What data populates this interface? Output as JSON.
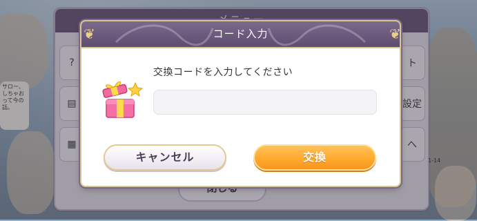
{
  "background": {
    "menu_title": "メニュー",
    "close_label": "閉じる",
    "side_items": [
      "ト",
      "設定",
      "へ"
    ],
    "chat_text": "サロー、しちゃおって今の話。",
    "date_text": "1-14",
    "colors": {
      "menu_header": "#6d5c7e"
    }
  },
  "dialog": {
    "title": "コード入力",
    "prompt": "交換コードを入力してください",
    "input": {
      "value": "",
      "placeholder": ""
    },
    "cancel_label": "キャンセル",
    "exchange_label": "交換",
    "icon": "gift-box-icon",
    "colors": {
      "header": "#6d5c7e",
      "border_gold": "#d9c68e",
      "exchange_button": "#ffaa2d",
      "cancel_button": "#f1eef4"
    }
  }
}
